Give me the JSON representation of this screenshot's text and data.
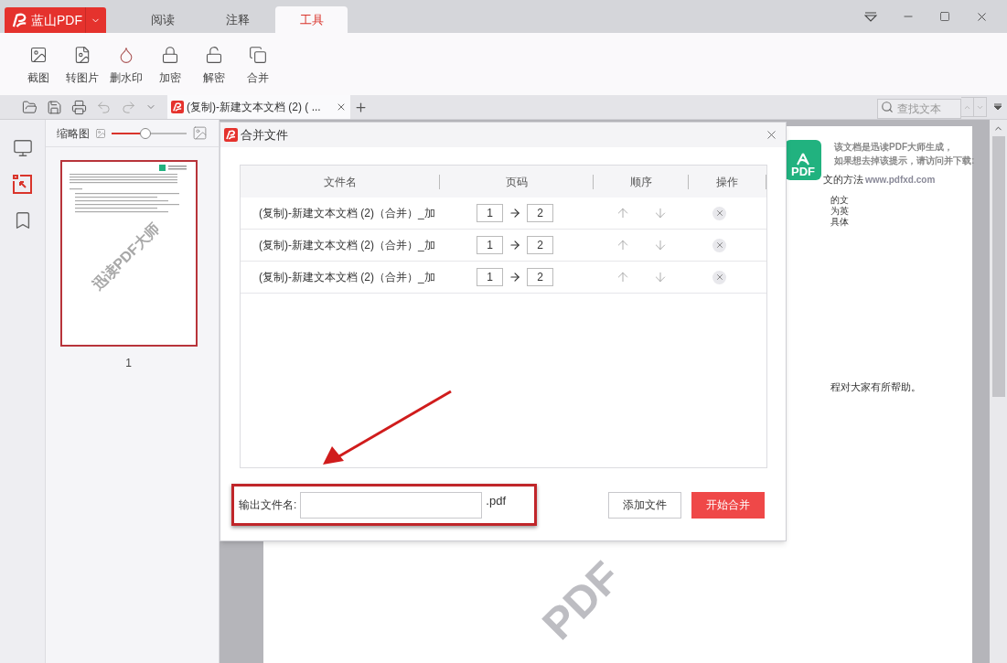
{
  "app": {
    "logo_text": "蓝山PDF"
  },
  "top_tabs": [
    {
      "label": "阅读",
      "selected": false
    },
    {
      "label": "注释",
      "selected": false
    },
    {
      "label": "工具",
      "selected": true
    }
  ],
  "tools": [
    {
      "label": "截图"
    },
    {
      "label": "转图片"
    },
    {
      "label": "删水印"
    },
    {
      "label": "加密"
    },
    {
      "label": "解密"
    },
    {
      "label": "合并"
    }
  ],
  "quick_actions": [
    {
      "disabled": false
    },
    {
      "disabled": false
    },
    {
      "disabled": false
    },
    {
      "disabled": true
    },
    {
      "disabled": true
    },
    {
      "disabled": false
    }
  ],
  "document_tab": {
    "title": "(复制)-新建文本文档 (2) ( ...",
    "selected": true
  },
  "search": {
    "placeholder": "查找文本"
  },
  "side_rail": [
    {
      "selected": false
    },
    {
      "selected": true
    },
    {
      "selected": false
    }
  ],
  "thumbnails": {
    "title": "缩略图",
    "zoom": {
      "level": 0.45
    },
    "pages": [
      {
        "number": "1",
        "selected": true,
        "watermark": "迅读PDF大师"
      }
    ]
  },
  "document": {
    "logo_text": "PDF",
    "notice": [
      "该文档是迅读PDF大师生成，",
      "如果想去掉该提示，请访问并下载:"
    ],
    "heading_fragment": "文的方法",
    "url": "www.pdfxd.com",
    "lines": [
      "的文",
      "为英",
      "具体"
    ],
    "closing": "程对大家有所帮助。",
    "watermark": "PDF"
  },
  "dialog": {
    "title": "合并文件",
    "columns": [
      "文件名",
      "页码",
      "顺序",
      "操作"
    ],
    "rows": [
      {
        "file": "(复制)-新建文本文档 (2)（合并）_加",
        "from": "1",
        "to": "2"
      },
      {
        "file": "(复制)-新建文本文档 (2)（合并）_加",
        "from": "1",
        "to": "2"
      },
      {
        "file": "(复制)-新建文本文档 (2)（合并）_加",
        "from": "1",
        "to": "2"
      }
    ],
    "output_label": "输出文件名:",
    "suffix": ".pdf",
    "buttons": [
      {
        "label": "添加文件",
        "kind": "secondary"
      },
      {
        "label": "开始合并",
        "kind": "primary"
      }
    ]
  }
}
